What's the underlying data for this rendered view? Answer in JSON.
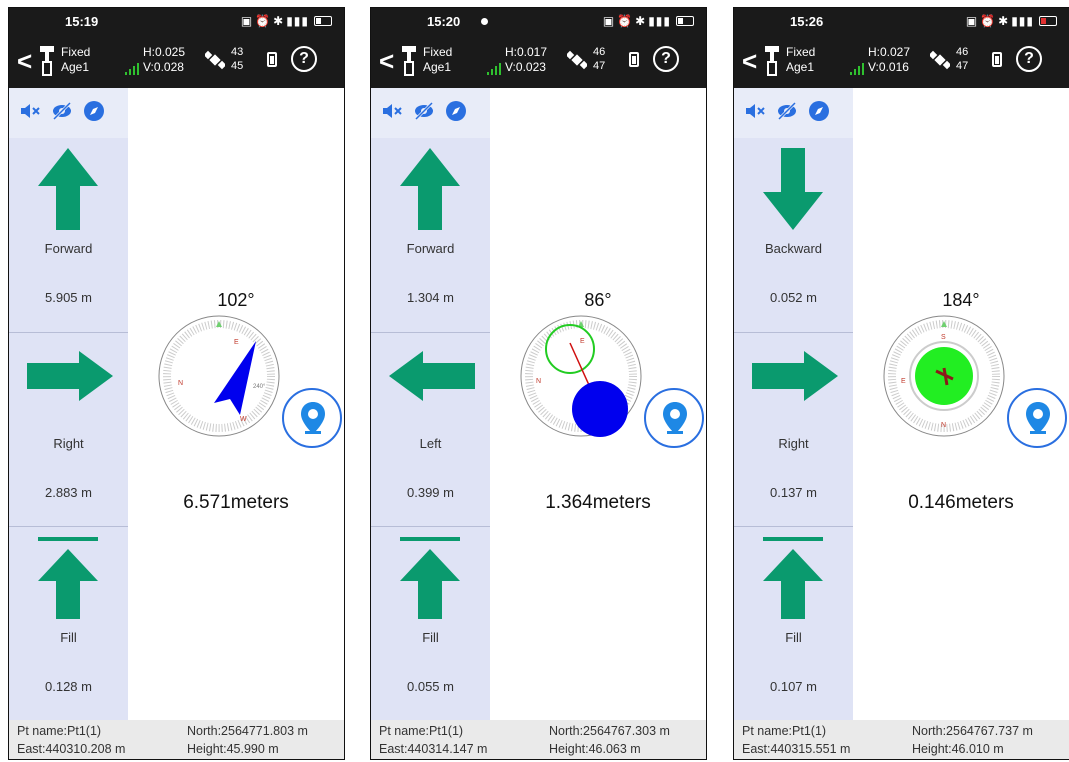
{
  "colors": {
    "accent": "#0a9a6e",
    "statusbar": "#1a1a1a",
    "sidebar": "#dfe3f5",
    "needle": "#0000ee"
  },
  "screens": [
    {
      "clock": "15:19",
      "header": {
        "fixed": "Fixed",
        "age": "Age1",
        "h": "H:0.025",
        "v": "V:0.028",
        "sat_top": "43",
        "sat_bottom": "45"
      },
      "sections": [
        {
          "direction": "up",
          "label": "Forward",
          "value": "5.905 m"
        },
        {
          "direction": "right",
          "label": "Right",
          "value": "2.883 m"
        },
        {
          "direction": "fill",
          "label": "Fill",
          "value": "0.128 m"
        }
      ],
      "heading": "102°",
      "distance": "6.571meters",
      "footer": {
        "pt_name": "Pt name:Pt1(1)",
        "north": "North:2564771.803 m",
        "east": "East:440310.208 m",
        "height": "Height:45.990 m"
      }
    },
    {
      "clock": "15:20",
      "header": {
        "fixed": "Fixed",
        "age": "Age1",
        "h": "H:0.017",
        "v": "V:0.023",
        "sat_top": "46",
        "sat_bottom": "47"
      },
      "sections": [
        {
          "direction": "up",
          "label": "Forward",
          "value": "1.304 m"
        },
        {
          "direction": "left",
          "label": "Left",
          "value": "0.399 m"
        },
        {
          "direction": "fill",
          "label": "Fill",
          "value": "0.055 m"
        }
      ],
      "heading": "86°",
      "distance": "1.364meters",
      "footer": {
        "pt_name": "Pt name:Pt1(1)",
        "north": "North:2564767.303 m",
        "east": "East:440314.147 m",
        "height": "Height:46.063 m"
      }
    },
    {
      "clock": "15:26",
      "header": {
        "fixed": "Fixed",
        "age": "Age1",
        "h": "H:0.027",
        "v": "V:0.016",
        "sat_top": "46",
        "sat_bottom": "47"
      },
      "sections": [
        {
          "direction": "down",
          "label": "Backward",
          "value": "0.052 m"
        },
        {
          "direction": "right",
          "label": "Right",
          "value": "0.137 m"
        },
        {
          "direction": "fill",
          "label": "Fill",
          "value": "0.107 m"
        }
      ],
      "heading": "184°",
      "distance": "0.146meters",
      "footer": {
        "pt_name": "Pt name:Pt1(1)",
        "north": "North:2564767.737 m",
        "east": "East:440315.551 m",
        "height": "Height:46.010 m"
      }
    }
  ]
}
